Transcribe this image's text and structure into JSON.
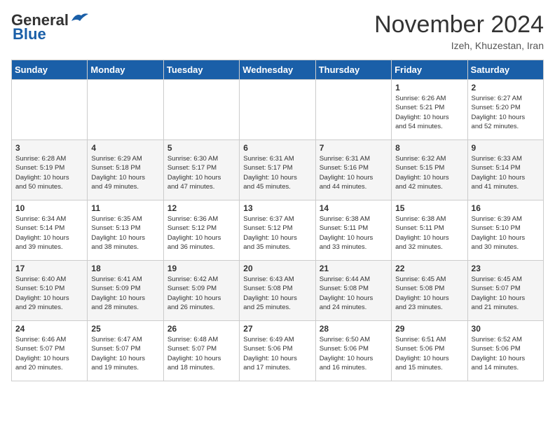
{
  "header": {
    "logo_line1": "General",
    "logo_line2": "Blue",
    "month": "November 2024",
    "location": "Izeh, Khuzestan, Iran"
  },
  "weekdays": [
    "Sunday",
    "Monday",
    "Tuesday",
    "Wednesday",
    "Thursday",
    "Friday",
    "Saturday"
  ],
  "weeks": [
    [
      {
        "day": "",
        "info": ""
      },
      {
        "day": "",
        "info": ""
      },
      {
        "day": "",
        "info": ""
      },
      {
        "day": "",
        "info": ""
      },
      {
        "day": "",
        "info": ""
      },
      {
        "day": "1",
        "info": "Sunrise: 6:26 AM\nSunset: 5:21 PM\nDaylight: 10 hours\nand 54 minutes."
      },
      {
        "day": "2",
        "info": "Sunrise: 6:27 AM\nSunset: 5:20 PM\nDaylight: 10 hours\nand 52 minutes."
      }
    ],
    [
      {
        "day": "3",
        "info": "Sunrise: 6:28 AM\nSunset: 5:19 PM\nDaylight: 10 hours\nand 50 minutes."
      },
      {
        "day": "4",
        "info": "Sunrise: 6:29 AM\nSunset: 5:18 PM\nDaylight: 10 hours\nand 49 minutes."
      },
      {
        "day": "5",
        "info": "Sunrise: 6:30 AM\nSunset: 5:17 PM\nDaylight: 10 hours\nand 47 minutes."
      },
      {
        "day": "6",
        "info": "Sunrise: 6:31 AM\nSunset: 5:17 PM\nDaylight: 10 hours\nand 45 minutes."
      },
      {
        "day": "7",
        "info": "Sunrise: 6:31 AM\nSunset: 5:16 PM\nDaylight: 10 hours\nand 44 minutes."
      },
      {
        "day": "8",
        "info": "Sunrise: 6:32 AM\nSunset: 5:15 PM\nDaylight: 10 hours\nand 42 minutes."
      },
      {
        "day": "9",
        "info": "Sunrise: 6:33 AM\nSunset: 5:14 PM\nDaylight: 10 hours\nand 41 minutes."
      }
    ],
    [
      {
        "day": "10",
        "info": "Sunrise: 6:34 AM\nSunset: 5:14 PM\nDaylight: 10 hours\nand 39 minutes."
      },
      {
        "day": "11",
        "info": "Sunrise: 6:35 AM\nSunset: 5:13 PM\nDaylight: 10 hours\nand 38 minutes."
      },
      {
        "day": "12",
        "info": "Sunrise: 6:36 AM\nSunset: 5:12 PM\nDaylight: 10 hours\nand 36 minutes."
      },
      {
        "day": "13",
        "info": "Sunrise: 6:37 AM\nSunset: 5:12 PM\nDaylight: 10 hours\nand 35 minutes."
      },
      {
        "day": "14",
        "info": "Sunrise: 6:38 AM\nSunset: 5:11 PM\nDaylight: 10 hours\nand 33 minutes."
      },
      {
        "day": "15",
        "info": "Sunrise: 6:38 AM\nSunset: 5:11 PM\nDaylight: 10 hours\nand 32 minutes."
      },
      {
        "day": "16",
        "info": "Sunrise: 6:39 AM\nSunset: 5:10 PM\nDaylight: 10 hours\nand 30 minutes."
      }
    ],
    [
      {
        "day": "17",
        "info": "Sunrise: 6:40 AM\nSunset: 5:10 PM\nDaylight: 10 hours\nand 29 minutes."
      },
      {
        "day": "18",
        "info": "Sunrise: 6:41 AM\nSunset: 5:09 PM\nDaylight: 10 hours\nand 28 minutes."
      },
      {
        "day": "19",
        "info": "Sunrise: 6:42 AM\nSunset: 5:09 PM\nDaylight: 10 hours\nand 26 minutes."
      },
      {
        "day": "20",
        "info": "Sunrise: 6:43 AM\nSunset: 5:08 PM\nDaylight: 10 hours\nand 25 minutes."
      },
      {
        "day": "21",
        "info": "Sunrise: 6:44 AM\nSunset: 5:08 PM\nDaylight: 10 hours\nand 24 minutes."
      },
      {
        "day": "22",
        "info": "Sunrise: 6:45 AM\nSunset: 5:08 PM\nDaylight: 10 hours\nand 23 minutes."
      },
      {
        "day": "23",
        "info": "Sunrise: 6:45 AM\nSunset: 5:07 PM\nDaylight: 10 hours\nand 21 minutes."
      }
    ],
    [
      {
        "day": "24",
        "info": "Sunrise: 6:46 AM\nSunset: 5:07 PM\nDaylight: 10 hours\nand 20 minutes."
      },
      {
        "day": "25",
        "info": "Sunrise: 6:47 AM\nSunset: 5:07 PM\nDaylight: 10 hours\nand 19 minutes."
      },
      {
        "day": "26",
        "info": "Sunrise: 6:48 AM\nSunset: 5:07 PM\nDaylight: 10 hours\nand 18 minutes."
      },
      {
        "day": "27",
        "info": "Sunrise: 6:49 AM\nSunset: 5:06 PM\nDaylight: 10 hours\nand 17 minutes."
      },
      {
        "day": "28",
        "info": "Sunrise: 6:50 AM\nSunset: 5:06 PM\nDaylight: 10 hours\nand 16 minutes."
      },
      {
        "day": "29",
        "info": "Sunrise: 6:51 AM\nSunset: 5:06 PM\nDaylight: 10 hours\nand 15 minutes."
      },
      {
        "day": "30",
        "info": "Sunrise: 6:52 AM\nSunset: 5:06 PM\nDaylight: 10 hours\nand 14 minutes."
      }
    ]
  ]
}
